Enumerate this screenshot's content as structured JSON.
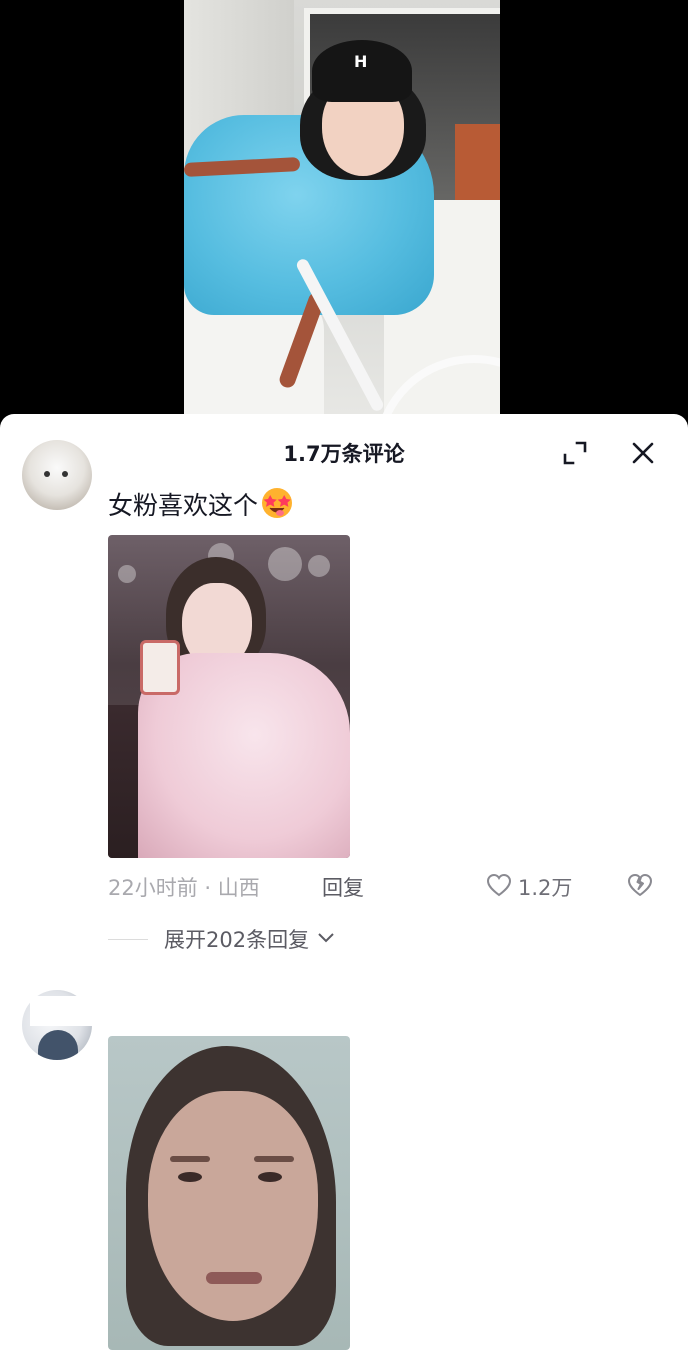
{
  "sheet": {
    "title": "1.7万条评论"
  },
  "comment1": {
    "text": "女粉喜欢这个",
    "emoji": "star-struck-emoji",
    "time": "22小时前",
    "separator": "·",
    "location": "山西",
    "reply_label": "回复",
    "like_count": "1.2万",
    "expand_replies": "展开202条回复"
  },
  "colors": {
    "sheet_bg": "#ffffff",
    "primary_text": "#161823",
    "secondary_text": "#a9a9ae",
    "video_bg": "#000000"
  }
}
